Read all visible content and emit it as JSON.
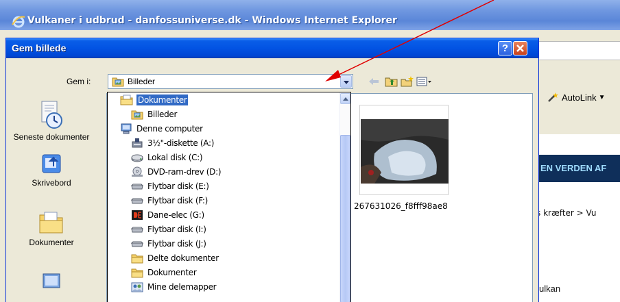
{
  "browser": {
    "title": "Vulkaner i udbrud - danfossuniverse.dk - Windows Internet Explorer",
    "autolink_label": "AutoLink",
    "banner_text": "EN VERDEN AF",
    "breadcrumb": "s kræfter  >  Vu",
    "page_text": "ulkan"
  },
  "dialog": {
    "title": "Gem billede",
    "help_label": "?",
    "lookin_label": "Gem i:",
    "lookin_value": "Billeder",
    "places": [
      {
        "label": "Seneste dokumenter",
        "icon": "recent-documents-icon"
      },
      {
        "label": "Skrivebord",
        "icon": "desktop-icon"
      },
      {
        "label": "Dokumenter",
        "icon": "documents-folder-icon"
      }
    ],
    "thumbnail_caption": "267631026_f8fff98ae8"
  },
  "dropdown": {
    "items": [
      {
        "label": "Dokumenter",
        "icon": "documents-icon",
        "indent": 1,
        "selected": true
      },
      {
        "label": "Billeder",
        "icon": "pictures-folder-icon",
        "indent": 2,
        "selected": false
      },
      {
        "label": "Denne computer",
        "icon": "computer-icon",
        "indent": 1,
        "selected": false
      },
      {
        "label": "3½\"-diskette (A:)",
        "icon": "floppy-icon",
        "indent": 2,
        "selected": false
      },
      {
        "label": "Lokal disk (C:)",
        "icon": "hard-disk-icon",
        "indent": 2,
        "selected": false
      },
      {
        "label": "DVD-ram-drev (D:)",
        "icon": "dvd-drive-icon",
        "indent": 2,
        "selected": false
      },
      {
        "label": "Flytbar disk (E:)",
        "icon": "removable-disk-icon",
        "indent": 2,
        "selected": false
      },
      {
        "label": "Flytbar disk (F:)",
        "icon": "removable-disk-icon",
        "indent": 2,
        "selected": false
      },
      {
        "label": "Dane-elec (G:)",
        "icon": "dane-elec-icon",
        "indent": 2,
        "selected": false
      },
      {
        "label": "Flytbar disk (I:)",
        "icon": "removable-disk-icon",
        "indent": 2,
        "selected": false
      },
      {
        "label": "Flytbar disk (J:)",
        "icon": "removable-disk-icon",
        "indent": 2,
        "selected": false
      },
      {
        "label": "Delte dokumenter",
        "icon": "shared-folder-icon",
        "indent": 2,
        "selected": false
      },
      {
        "label": "Dokumenter",
        "icon": "folder-icon",
        "indent": 2,
        "selected": false
      },
      {
        "label": "Mine delemapper",
        "icon": "shared-folders-icon",
        "indent": 2,
        "selected": false
      }
    ]
  },
  "colors": {
    "selection": "#316ac5",
    "title_bar": "#0253e3",
    "arrow": "#e00000"
  }
}
